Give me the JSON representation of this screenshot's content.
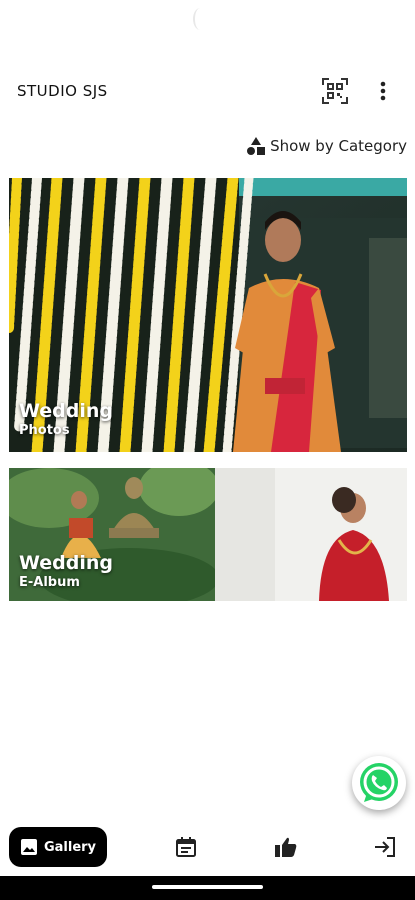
{
  "app": {
    "title": "STUDIO SJS"
  },
  "header": {
    "qr_icon": "qr-scan-icon",
    "more_icon": "more-vert-icon"
  },
  "category_button": {
    "label": "Show by Category",
    "icon": "category-shapes-icon"
  },
  "cards": [
    {
      "title": "Wedding",
      "subtitle": "Photos"
    },
    {
      "title": "Wedding",
      "subtitle": "E-Album"
    }
  ],
  "fab": {
    "icon": "whatsapp-icon",
    "color": "#25D366"
  },
  "bottom_nav": {
    "gallery_label": "Gallery",
    "items": [
      "gallery-icon",
      "calendar-icon",
      "thumbs-up-icon",
      "logout-icon"
    ]
  },
  "colors": {
    "primary": "#000000",
    "accent_whatsapp": "#25D366"
  }
}
